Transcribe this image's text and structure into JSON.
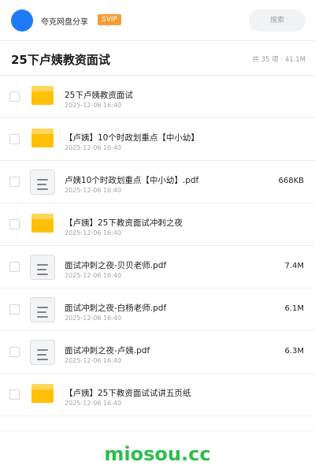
{
  "header": {
    "share_title": "夸克网盘分享",
    "badge": "SVIP",
    "search_label": "搜索",
    "avatar_color": "#1e7bf5"
  },
  "folder": {
    "title": "25下卢姨教资面试",
    "summary": "共 35 项 · 41.1M"
  },
  "items": [
    {
      "type": "folder",
      "icon": "folder-icon",
      "name": "25下卢姨教资面试",
      "date": "2025-12-06 16:40",
      "size": ""
    },
    {
      "type": "folder",
      "icon": "folder-icon",
      "name": "【卢姨】10个时政划重点【中小幼】",
      "date": "2025-12-06 16:40",
      "size": ""
    },
    {
      "type": "file",
      "icon": "document-icon",
      "name": "卢姨10个时政划重点【中小幼】.pdf",
      "date": "2025-12-06 16:40",
      "size": "668KB"
    },
    {
      "type": "folder",
      "icon": "folder-icon",
      "name": "【卢姨】25下教资面试冲刺之夜",
      "date": "2025-12-06 16:40",
      "size": ""
    },
    {
      "type": "file",
      "icon": "document-icon",
      "name": "面试冲刺之夜-贝贝老师.pdf",
      "date": "2025-12-06 16:40",
      "size": "7.4M"
    },
    {
      "type": "file",
      "icon": "document-icon",
      "name": "面试冲刺之夜-白杨老师.pdf",
      "date": "2025-12-06 16:40",
      "size": "6.1M"
    },
    {
      "type": "file",
      "icon": "document-icon",
      "name": "面试冲刺之夜-卢姨.pdf",
      "date": "2025-12-06 16:40",
      "size": "6.3M"
    },
    {
      "type": "folder",
      "icon": "folder-icon",
      "name": "【卢姨】25下教资面试试讲五页纸",
      "date": "2025-12-06 16:40",
      "size": ""
    }
  ],
  "watermark": "miosou.cc",
  "colors": {
    "folder": "#ffc107",
    "badge": "#f59b32",
    "watermark": "#2ebd4e"
  }
}
